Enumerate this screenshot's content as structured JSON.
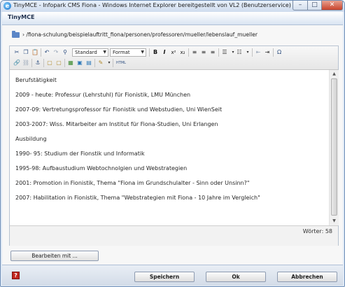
{
  "window": {
    "title": "TinyMCE - Infopark CMS Fiona - Windows Internet Explorer bereitgestellt von VL2 (Benutzerservice)",
    "app_icon": "internet-explorer-icon",
    "minimize_glyph": "–",
    "maximize_glyph": "□",
    "close_glyph": "✕"
  },
  "dialog": {
    "header": "TinyMCE",
    "path": "› /fiona-schulung/beispielauftritt_fiona/personen/professoren/mueller/lebenslauf_mueller"
  },
  "toolbar": {
    "icons": {
      "cut": "✂",
      "copy": "❐",
      "paste": "📋",
      "undo": "↶",
      "redo": "↷",
      "find": "⚲",
      "bold": "B",
      "italic": "I",
      "superscript": "x²",
      "subscript": "x₂",
      "align_left": "≡",
      "align_center": "≡",
      "align_right": "≡",
      "bullet_list": "☰",
      "numbered_list": "☷",
      "outdent": "⇤",
      "indent": "⇥",
      "special_char": "Ω",
      "anchor": "⚓",
      "link": "🔗",
      "unlink": "⛓",
      "table": "▦",
      "image": "▣",
      "media": "▤",
      "edit_attr": "✎",
      "html": "HTML",
      "hr": "—",
      "box": "▢"
    },
    "style_select": "Standard",
    "format_select": "Format"
  },
  "document": {
    "paragraphs": [
      "Berufstätigkeit",
      "2009 - heute: Professur (Lehrstuhl) für Fionistik, LMU München",
      "2007-09: Vertretungsprofessor für Fionistik und Webstudien, Uni WienSeit",
      "2003-2007: Wiss. Mitarbeiter am Institut für Fiona-Studien, Uni Erlangen",
      "Ausbildung",
      "1990- 95: Studium der Fionstik und Informatik",
      "1995-98: Aufbaustudium Webtochnolgien und Webstrategien",
      "2001: Promotion in Fionistik, Thema \"Fiona im Grundschulalter - Sinn oder Unsinn?\"",
      "2007: Habilitation in Fionistik, Thema \"Webstrategien mit Fiona - 10 Jahre im Vergleich\""
    ],
    "word_count": "Wörter: 58"
  },
  "buttons": {
    "edit_with": "Bearbeiten mit ...",
    "save": "Speichern",
    "ok": "Ok",
    "cancel": "Abbrechen",
    "help": "?"
  },
  "colors": {
    "accent": "#5b86c7",
    "help_red": "#c2261d",
    "close_red": "#c8432c"
  }
}
